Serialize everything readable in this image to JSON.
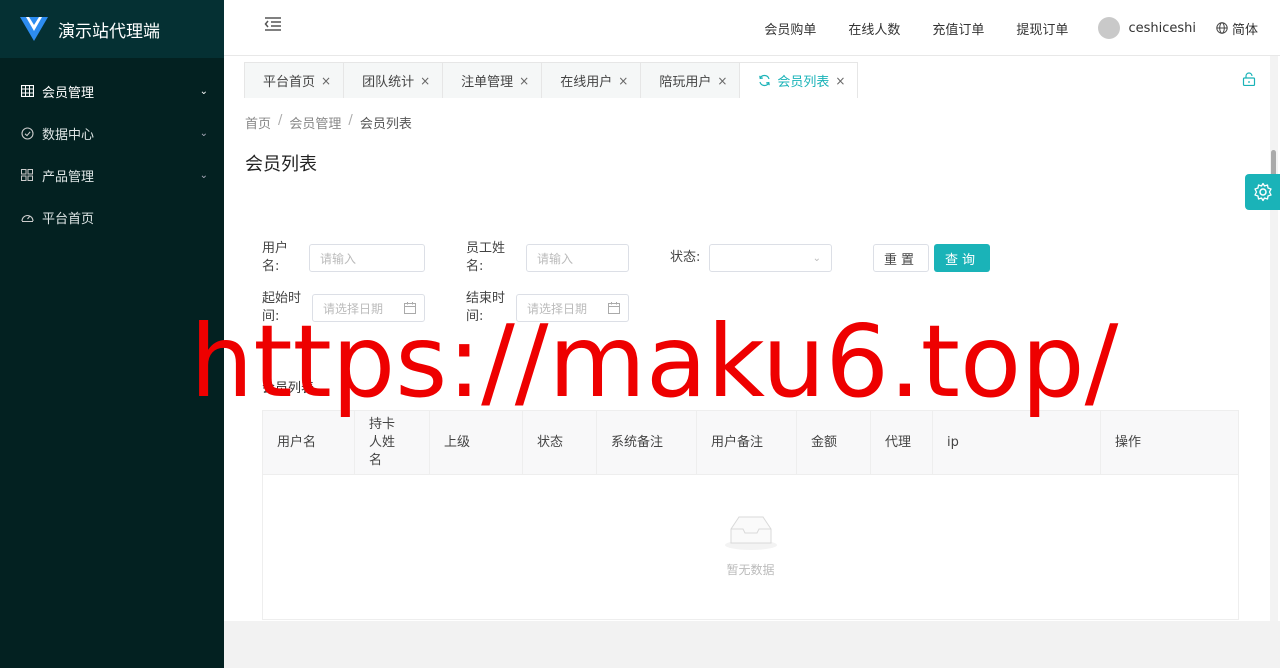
{
  "brand": {
    "title": "演示站代理端",
    "logo_icon": "v-logo-icon"
  },
  "sidebar": {
    "items": [
      {
        "label": "会员管理",
        "icon": "grid-icon",
        "arrow": "⌄",
        "expanded": true
      },
      {
        "label": "数据中心",
        "icon": "check-circle-icon",
        "arrow": "⌄"
      },
      {
        "label": "产品管理",
        "icon": "apps-icon",
        "arrow": "⌄"
      },
      {
        "label": "平台首页",
        "icon": "dashboard-icon",
        "arrow": ""
      }
    ]
  },
  "header": {
    "links": [
      "会员购单",
      "在线人数",
      "充值订单",
      "提现订单"
    ],
    "user_name": "ceshiceshi",
    "language": "简体"
  },
  "tabs": [
    {
      "label": "平台首页",
      "close": "×"
    },
    {
      "label": "团队统计",
      "close": "×"
    },
    {
      "label": "注单管理",
      "close": "×"
    },
    {
      "label": "在线用户",
      "close": "×"
    },
    {
      "label": "陪玩用户",
      "close": "×"
    },
    {
      "label": "会员列表",
      "close": "×",
      "active": true
    }
  ],
  "breadcrumb": {
    "items": [
      "首页",
      "会员管理",
      "会员列表"
    ],
    "separator": "/"
  },
  "page_title": "会员列表",
  "search": {
    "username_label_1": "用户",
    "username_label_2": "名:",
    "username_placeholder": "请输入",
    "staff_label_1": "员工姓",
    "staff_label_2": "名:",
    "staff_placeholder": "请输入",
    "status_label": "状态:",
    "status_chevron": "⌄",
    "start_label_1": "起始时",
    "start_label_2": "间:",
    "start_placeholder": "请选择日期",
    "end_label_1": "结束时",
    "end_label_2": "间:",
    "end_placeholder": "请选择日期",
    "reset_label": "重置",
    "search_label": "查询"
  },
  "table": {
    "caption": "会员列表",
    "columns": [
      "用户名",
      "持卡人姓名",
      "上级",
      "状态",
      "系统备注",
      "用户备注",
      "金额",
      "代理",
      "ip",
      "操作"
    ],
    "empty_text": "暂无数据"
  },
  "watermark": "https://maku6.top/",
  "colors": {
    "sidebar_bg": "#032121",
    "accent": "#1ab3b8",
    "watermark": "#ee0000"
  }
}
